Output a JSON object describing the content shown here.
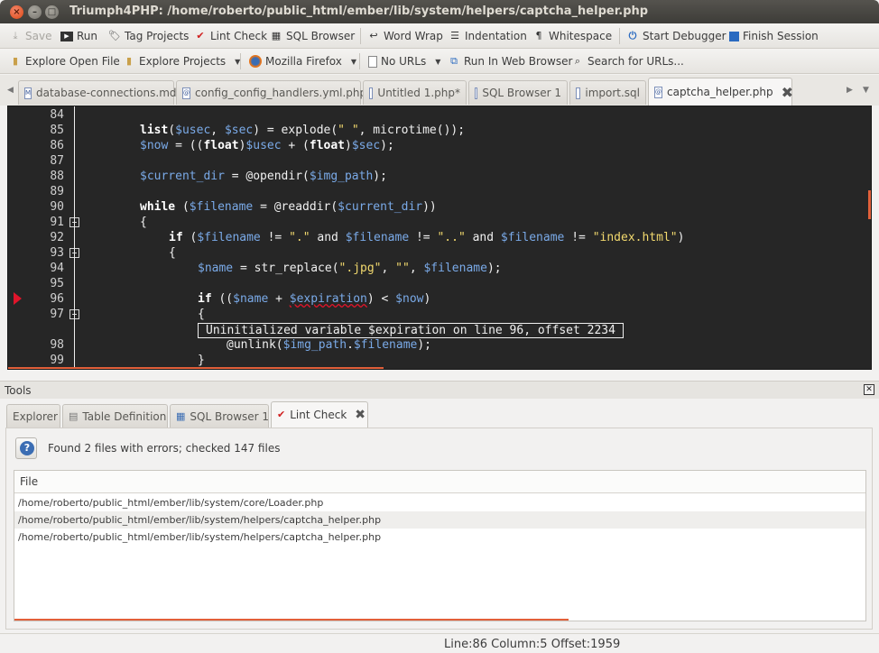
{
  "window": {
    "title": "Triumph4PHP: /home/roberto/public_html/ember/lib/system/helpers/captcha_helper.php"
  },
  "toolbar1": {
    "save": "Save",
    "run": "Run",
    "tag_projects": "Tag Projects",
    "lint_check": "Lint Check",
    "sql_browser": "SQL Browser",
    "word_wrap": "Word Wrap",
    "indentation": "Indentation",
    "whitespace": "Whitespace",
    "start_debugger": "Start Debugger",
    "finish_session": "Finish Session"
  },
  "toolbar2": {
    "explore_open_file": "Explore Open File",
    "explore_projects": "Explore Projects",
    "browser": "Mozilla Firefox",
    "url_mode": "No URLs",
    "run_in_browser": "Run In Web Browser",
    "search_urls": "Search for URLs..."
  },
  "editor_tabs": [
    {
      "label": "database-connections.md"
    },
    {
      "label": "config_config_handlers.yml.php"
    },
    {
      "label": "Untitled 1.php*"
    },
    {
      "label": "SQL Browser 1"
    },
    {
      "label": "import.sql"
    },
    {
      "label": "captcha_helper.php"
    }
  ],
  "code": {
    "line_numbers": [
      "84",
      "85",
      "86",
      "87",
      "88",
      "89",
      "90",
      "91",
      "92",
      "93",
      "94",
      "95",
      "96",
      "97",
      "98",
      "99"
    ],
    "lines": [
      {
        "text": ""
      },
      {
        "text": "list($usec, $sec) = explode(\" \", microtime());"
      },
      {
        "text": "$now = ((float)$usec + (float)$sec);"
      },
      {
        "text": ""
      },
      {
        "text": "$current_dir = @opendir($img_path);"
      },
      {
        "text": ""
      },
      {
        "text": "while ($filename = @readdir($current_dir))"
      },
      {
        "text": "{"
      },
      {
        "text": "if ($filename != \".\" and $filename != \"..\" and $filename != \"index.html\")"
      },
      {
        "text": "{"
      },
      {
        "text": "$name = str_replace(\".jpg\", \"\", $filename);"
      },
      {
        "text": ""
      },
      {
        "text": "if (($name + $expiration) < $now)"
      },
      {
        "text": "{"
      },
      {
        "text": "@unlink($img_path.$filename);"
      },
      {
        "text": "}"
      }
    ],
    "tooltip": "Uninitialized variable $expiration on line 96, offset 2234"
  },
  "tools": {
    "title": "Tools",
    "tabs": [
      {
        "label": "Explorer"
      },
      {
        "label": "Table Definition"
      },
      {
        "label": "SQL Browser 1"
      },
      {
        "label": "Lint Check"
      }
    ],
    "lint": {
      "message": "Found 2 files with errors; checked 147 files",
      "column_header": "File",
      "rows": [
        "/home/roberto/public_html/ember/lib/system/core/Loader.php",
        "/home/roberto/public_html/ember/lib/system/helpers/captcha_helper.php",
        "/home/roberto/public_html/ember/lib/system/helpers/captcha_helper.php"
      ]
    }
  },
  "statusbar": {
    "text": "Line:86 Column:5 Offset:1959"
  }
}
